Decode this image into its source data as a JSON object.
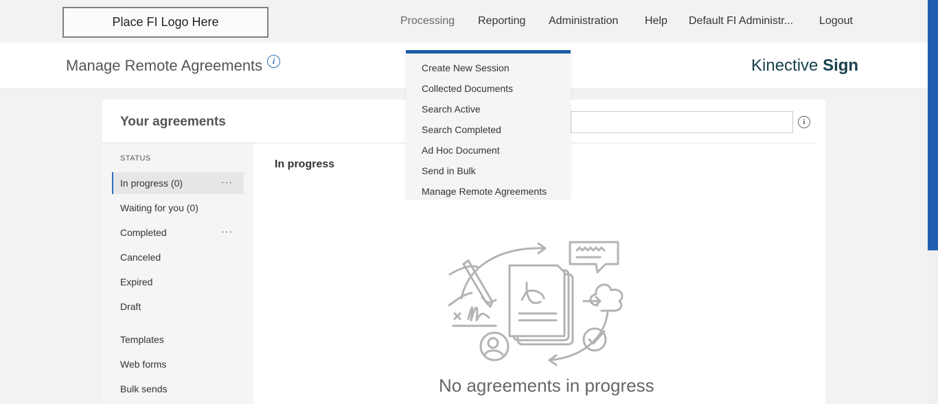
{
  "topnav": {
    "logo_text": "Place FI Logo Here",
    "items": [
      {
        "label": "Processing"
      },
      {
        "label": "Reporting"
      },
      {
        "label": "Administration"
      },
      {
        "label": "Help"
      },
      {
        "label": "Default FI Administr..."
      },
      {
        "label": "Logout"
      }
    ]
  },
  "header": {
    "title": "Manage Remote Agreements",
    "brand_prefix": "Kinective",
    "brand_bold": "Sign"
  },
  "dropdown": {
    "items": [
      {
        "label": "Create New Session"
      },
      {
        "label": "Collected Documents"
      },
      {
        "label": "Search Active"
      },
      {
        "label": "Search Completed"
      },
      {
        "label": "Ad Hoc Document"
      },
      {
        "label": "Send in Bulk"
      },
      {
        "label": "Manage Remote Agreements"
      }
    ]
  },
  "card": {
    "title": "Your agreements",
    "status_label": "STATUS",
    "sidebar_items": [
      {
        "label": "In progress (0)"
      },
      {
        "label": "Waiting for you (0)"
      },
      {
        "label": "Completed"
      },
      {
        "label": "Canceled"
      },
      {
        "label": "Expired"
      },
      {
        "label": "Draft"
      },
      {
        "label": "Templates"
      },
      {
        "label": "Web forms"
      },
      {
        "label": "Bulk sends"
      }
    ],
    "more_glyph": "···",
    "content_heading": "In progress",
    "empty_message": "No agreements in progress"
  },
  "colors": {
    "accent_blue": "#1c5ea8",
    "brand_dark": "#18404a"
  },
  "icons": [
    "info-icon",
    "more-icon",
    "empty-state-illustration"
  ]
}
